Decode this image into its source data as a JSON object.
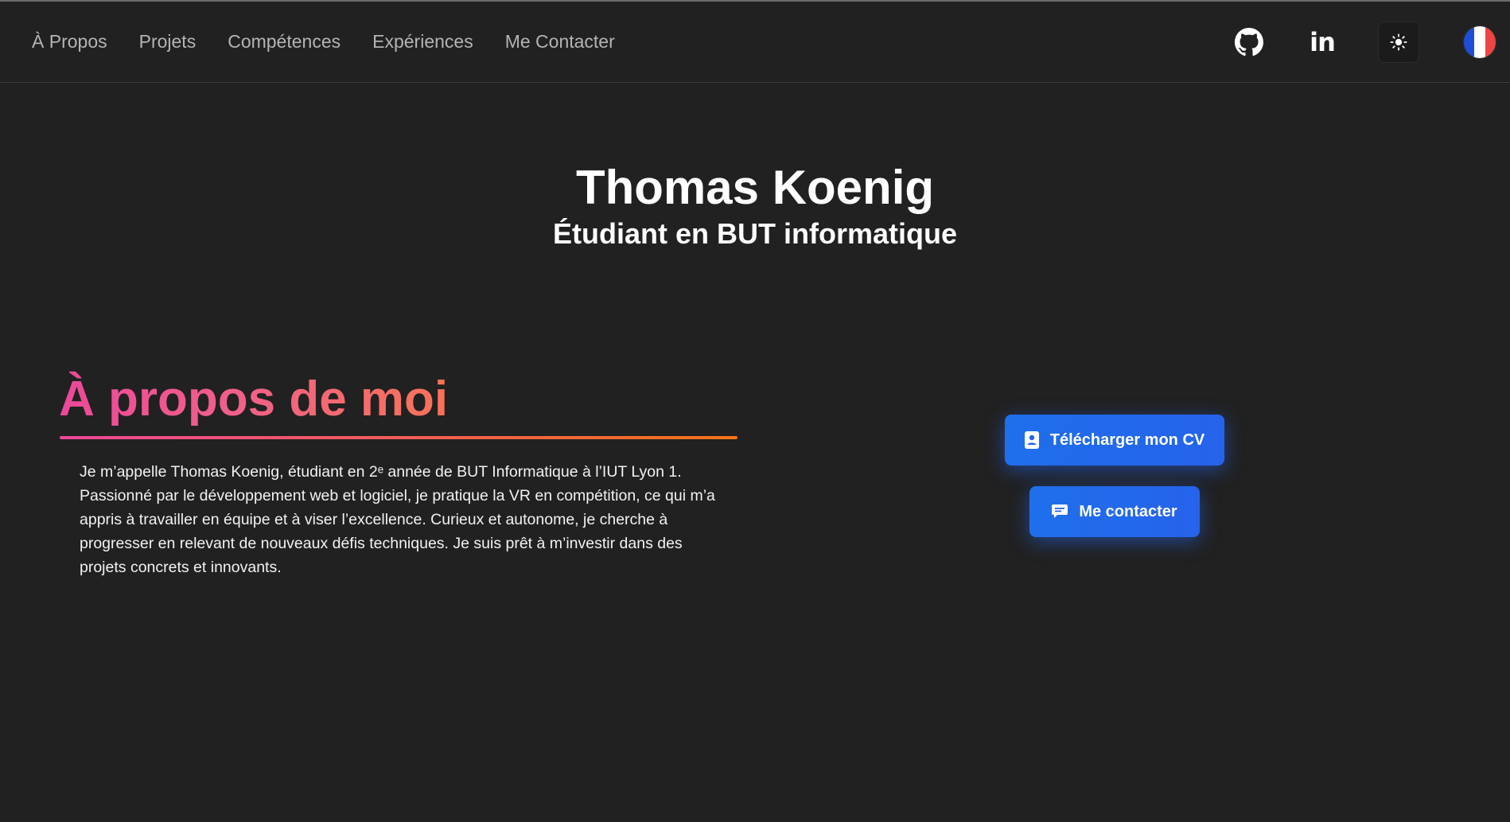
{
  "nav": {
    "links": [
      "À Propos",
      "Projets",
      "Compétences",
      "Expériences",
      "Me Contacter"
    ],
    "icons": [
      "github-icon",
      "linkedin-icon",
      "sun-icon",
      "flag-fr-icon"
    ],
    "linkedin_glyph": "in"
  },
  "hero": {
    "name": "Thomas Koenig",
    "subtitle": "Étudiant en BUT informatique"
  },
  "about": {
    "title": "À propos de moi",
    "text": "Je m’appelle Thomas Koenig, étudiant en 2ᵉ année de BUT Informatique à l’IUT Lyon 1. Passionné par le développement web et logiciel, je pratique la VR en compétition, ce qui m’a appris à travailler en équipe et à viser l’excellence. Curieux et autonome, je cherche à progresser en relevant de nouveaux défis techniques. Je suis prêt à m’investir dans des projets concrets et innovants."
  },
  "actions": {
    "cv_label": "Télécharger mon CV",
    "contact_label": "Me contacter"
  },
  "colors": {
    "background": "#212121",
    "accent_blue": "#2563eb",
    "gradient_start": "#ec4899",
    "gradient_end": "#f97316"
  }
}
